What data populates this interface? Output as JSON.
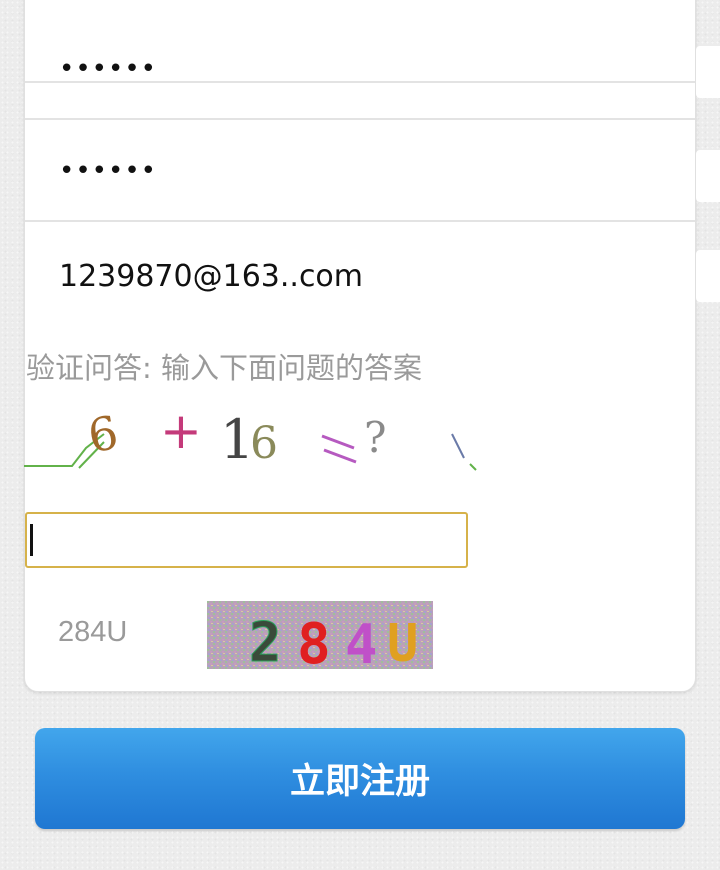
{
  "form": {
    "password": "••••••",
    "confirm_password": "••••••",
    "email": "1239870@163..com"
  },
  "verification": {
    "question_label": "验证问答: 输入下面问题的答案",
    "question_image_text": "6 + 16 =?",
    "answer_value": "",
    "captcha_code_label": "284U",
    "captcha_image_text": "284U"
  },
  "submit_label": "立即注册",
  "colors": {
    "button": "#2f8ee0",
    "answer_border": "#d6b24a",
    "label": "#9a9a9a"
  }
}
